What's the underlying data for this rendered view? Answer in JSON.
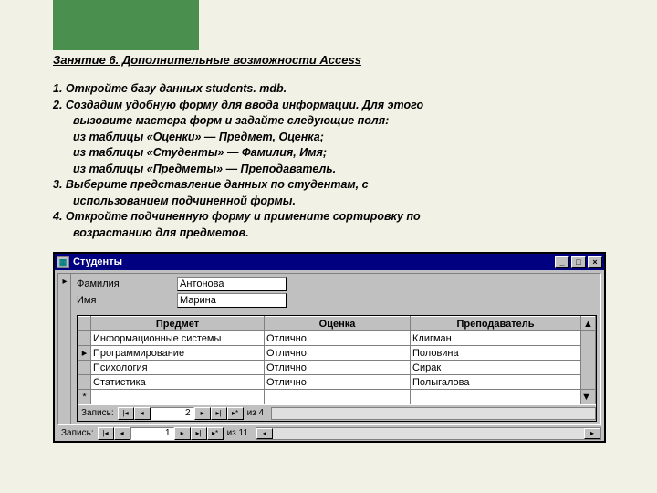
{
  "title": "Занятие 6. Дополнительные возможности Access",
  "instructions": {
    "l1": "1. Откройте базу данных students. mdb.",
    "l2": "2. Создадим удобную форму для ввода информации. Для этого",
    "l2a": "вызовите мастера форм и задайте следующие поля:",
    "l2b": "из таблицы «Оценки» — Предмет, Оценка;",
    "l2c": "из таблицы «Студенты» — Фамилия, Имя;",
    "l2d": "из таблицы «Предметы» — Преподаватель.",
    "l3": "3. Выберите представление данных по студентам, с",
    "l3a": "использованием подчиненной формы.",
    "l4": "4. Откройте подчиненную форму и примените сортировку по",
    "l4a": "возрастанию для предметов."
  },
  "window": {
    "title": "Студенты",
    "labels": {
      "surname": "Фамилия",
      "name": "Имя"
    },
    "values": {
      "surname": "Антонова",
      "name": "Марина"
    }
  },
  "subform": {
    "headers": {
      "subject": "Предмет",
      "grade": "Оценка",
      "teacher": "Преподаватель"
    },
    "rows": [
      {
        "subject": "Информационные системы",
        "grade": "Отлично",
        "teacher": "Клигман"
      },
      {
        "subject": "Программирование",
        "grade": "Отлично",
        "teacher": "Половина"
      },
      {
        "subject": "Психология",
        "grade": "Отлично",
        "teacher": "Сирак"
      },
      {
        "subject": "Статистика",
        "grade": "Отлично",
        "teacher": "Полыгалова"
      }
    ],
    "nav": {
      "label": "Запись:",
      "current": "2",
      "of_label": "из",
      "total": "4"
    }
  },
  "outer_nav": {
    "label": "Запись:",
    "current": "1",
    "of_label": "из",
    "total": "11"
  }
}
